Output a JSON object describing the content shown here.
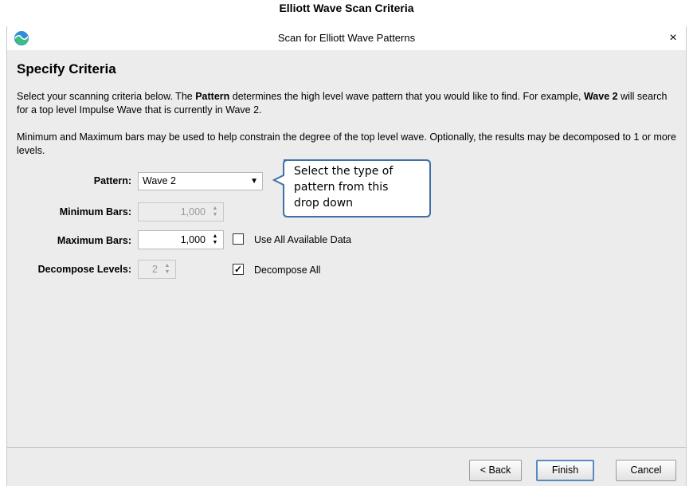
{
  "caption": "Elliott Wave Scan Criteria",
  "window": {
    "title": "Scan for Elliott Wave Patterns",
    "close_label": "×"
  },
  "heading": "Specify Criteria",
  "description": {
    "p1_a": "Select your scanning criteria below. The ",
    "p1_b": "Pattern",
    "p1_c": " determines the high level wave pattern that you would like to find. For example, ",
    "p1_d": "Wave 2",
    "p1_e": " will search for a top level Impulse Wave that is currently in Wave 2.",
    "p2": "Minimum and Maximum bars may be used to help constrain the degree of the top level wave. Optionally, the results may be decomposed to 1 or more levels."
  },
  "form": {
    "pattern_label": "Pattern:",
    "pattern_value": "Wave 2",
    "min_bars_label": "Minimum Bars:",
    "min_bars_value": "1,000",
    "max_bars_label": "Maximum Bars:",
    "max_bars_value": "1,000",
    "decompose_label": "Decompose Levels:",
    "decompose_value": "2",
    "use_all_label": "Use All Available Data",
    "use_all_checked": false,
    "decompose_all_label": "Decompose All",
    "decompose_all_checked": true
  },
  "callout": {
    "line1": "Select the type of",
    "line2": "pattern from this",
    "line3": "drop down"
  },
  "buttons": {
    "back": "< Back",
    "finish": "Finish",
    "cancel": "Cancel"
  },
  "colors": {
    "accent": "#5a8ac2",
    "callout_border": "#3f6fa6"
  }
}
